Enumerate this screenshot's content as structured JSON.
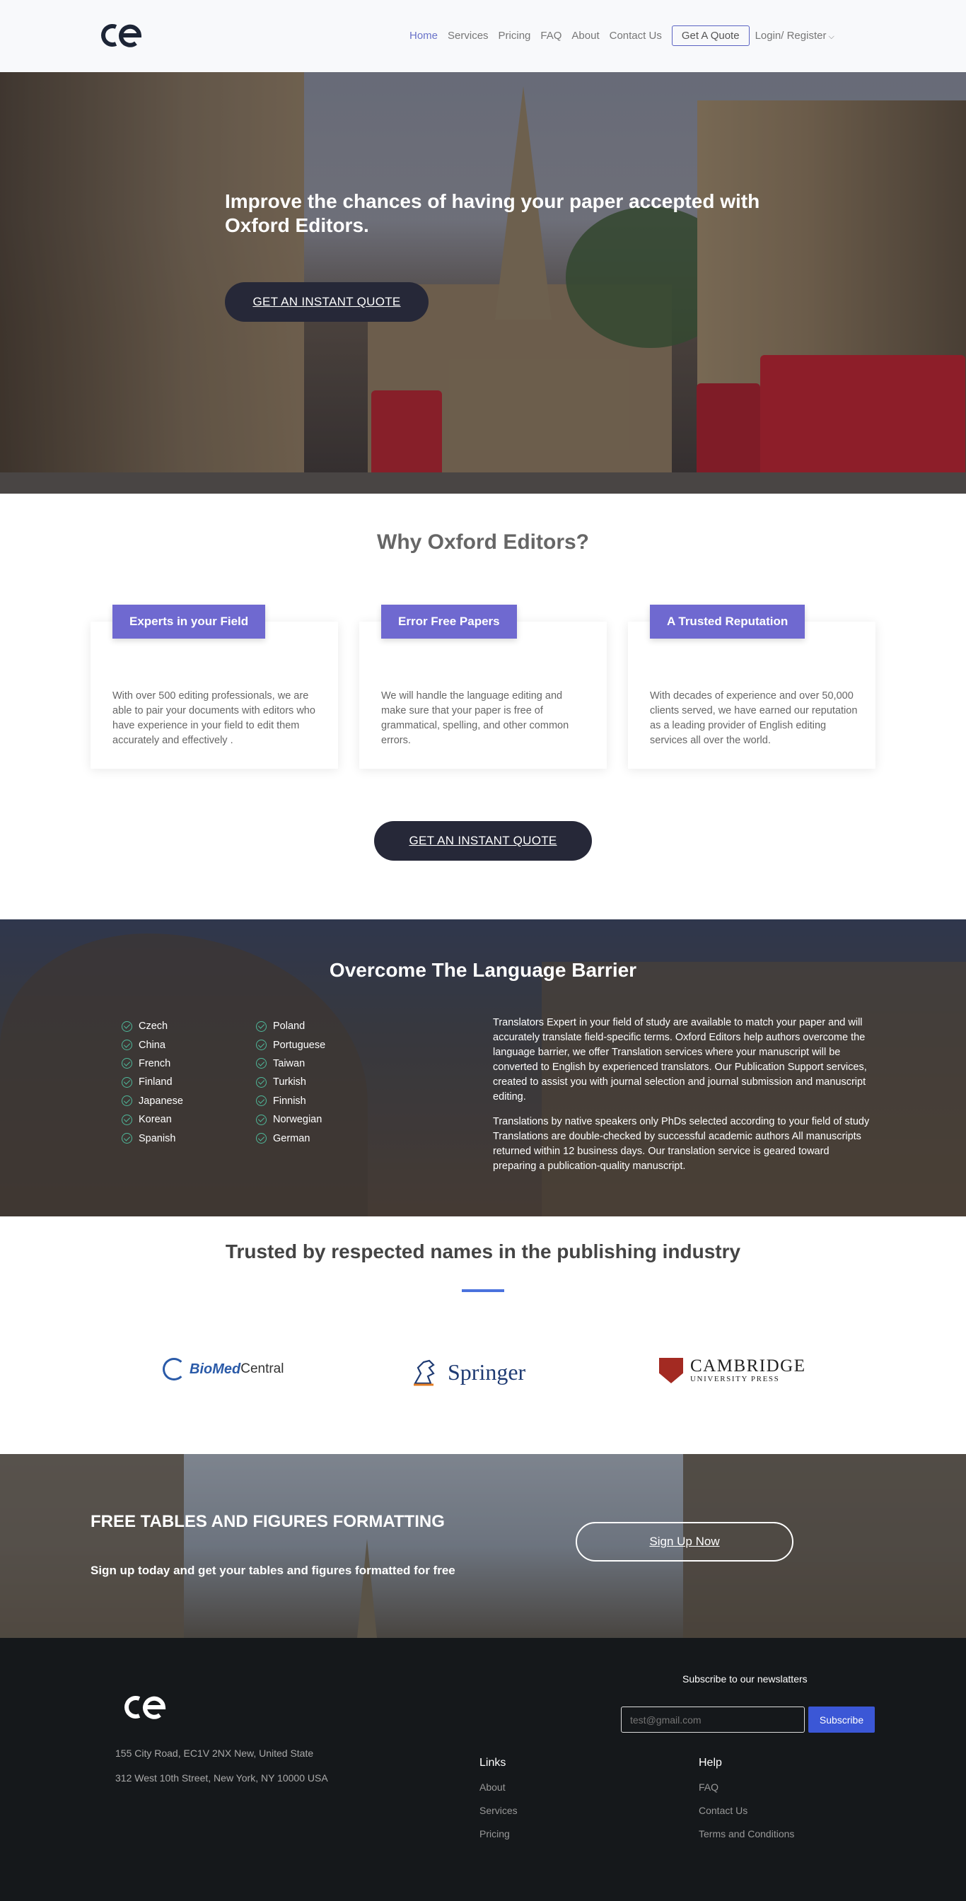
{
  "header": {
    "logo_text": "ce",
    "nav": [
      {
        "label": "Home"
      },
      {
        "label": "Services"
      },
      {
        "label": "Pricing"
      },
      {
        "label": "FAQ"
      },
      {
        "label": "About"
      },
      {
        "label": "Contact Us"
      }
    ],
    "quote_button": "Get A Quote",
    "login_label": "Login/ Register",
    "accent_color": "#6a73c9"
  },
  "hero": {
    "title": "Improve the chances of having your paper accepted with Oxford Editors.",
    "button": "GET AN INSTANT QUOTE"
  },
  "why": {
    "title": "Why Oxford Editors?",
    "cards": [
      {
        "tag": "Experts in your Field",
        "text": "With over 500 editing professionals, we are able to pair your documents with editors who have experience in your field to edit them accurately and effectively ."
      },
      {
        "tag": "Error Free Papers",
        "text": "We will handle the language editing and make sure that your paper is free of grammatical, spelling, and other common errors."
      },
      {
        "tag": "A Trusted Reputation",
        "text": "With decades of experience and over 50,000 clients served, we have earned our reputation as a leading provider of English editing services all over the world."
      }
    ],
    "button": "GET AN INSTANT QUOTE",
    "tag_color": "#6f69d0"
  },
  "language": {
    "title": "Overcome The Language Barrier",
    "col1": [
      "Czech",
      "China",
      "French",
      "Finland",
      "Japanese",
      "Korean",
      "Spanish"
    ],
    "col2": [
      "Poland",
      "Portuguese",
      "Taiwan",
      "Turkish",
      "Finnish",
      "Norwegian",
      "German"
    ],
    "para1": "Translators Expert in your field of study are available to match your paper and will accurately translate field-specific terms. Oxford Editors help authors overcome the language barrier, we offer Translation services where your manuscript will be converted to English by experienced translators. Our Publication Support services, created to assist you with journal selection and journal submission and manuscript editing.",
    "para2": "Translations by native speakers only PhDs selected according to your field of study Translations are double-checked by successful academic authors All manuscripts returned within 12 business days. Our translation service is geared toward preparing a publication-quality manuscript."
  },
  "trusted": {
    "title": "Trusted by respected names in the publishing industry",
    "partners": {
      "biomed_a": "BioMed",
      "biomed_b": "Central",
      "springer": "Springer",
      "cambridge_a": "CAMBRIDGE",
      "cambridge_b": "UNIVERSITY PRESS"
    }
  },
  "cta": {
    "title": "FREE TABLES AND FIGURES FORMATTING",
    "subtitle": "Sign up today and get your tables and figures formatted for free",
    "button": "Sign Up Now"
  },
  "footer": {
    "address1": "155 City Road, EC1V 2NX New, United State",
    "address2": "312 West 10th Street, New York, NY 10000 USA",
    "newsletter_label": "Subscribe to our newslatters",
    "newsletter_placeholder": "test@gmail.com",
    "subscribe_button": "Subscribe",
    "links": {
      "title": "Links",
      "items": [
        "About",
        "Services",
        "Pricing"
      ]
    },
    "help": {
      "title": "Help",
      "items": [
        "FAQ",
        "Contact Us",
        "Terms and Conditions"
      ]
    }
  }
}
